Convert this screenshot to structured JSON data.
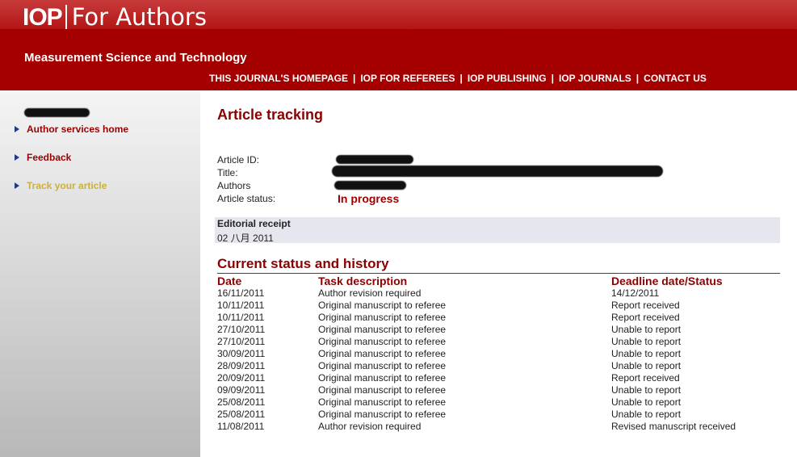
{
  "header": {
    "brand_iop": "IOP",
    "brand_rest": "For Authors",
    "journal": "Measurement Science and Technology",
    "nav": [
      "THIS JOURNAL'S HOMEPAGE",
      "IOP FOR REFEREES",
      "IOP PUBLISHING",
      "IOP JOURNALS",
      "CONTACT US"
    ]
  },
  "sidebar": {
    "items": [
      {
        "label": "Author services home"
      },
      {
        "label": "Feedback"
      },
      {
        "label": "Track your article"
      }
    ]
  },
  "main": {
    "title": "Article tracking",
    "fields": {
      "article_id_label": "Article ID:",
      "title_label": "Title:",
      "authors_label": "Authors",
      "status_label": "Article status:",
      "status_value": "In progress"
    },
    "receipt": {
      "label": "Editorial receipt",
      "value": "02 八月 2011"
    },
    "history_title": "Current status and history",
    "columns": [
      "Date",
      "Task description",
      "Deadline date/Status"
    ],
    "rows": [
      [
        "16/11/2011",
        "Author revision required",
        "14/12/2011"
      ],
      [
        "10/11/2011",
        "Original manuscript to referee",
        "Report received"
      ],
      [
        "10/11/2011",
        "Original manuscript to referee",
        "Report received"
      ],
      [
        "27/10/2011",
        "Original manuscript to referee",
        "Unable to report"
      ],
      [
        "27/10/2011",
        "Original manuscript to referee",
        "Unable to report"
      ],
      [
        "30/09/2011",
        "Original manuscript to referee",
        "Unable to report"
      ],
      [
        "28/09/2011",
        "Original manuscript to referee",
        "Unable to report"
      ],
      [
        "20/09/2011",
        "Original manuscript to referee",
        "Report received"
      ],
      [
        "09/09/2011",
        "Original manuscript to referee",
        "Unable to report"
      ],
      [
        "25/08/2011",
        "Original manuscript to referee",
        "Unable to report"
      ],
      [
        "25/08/2011",
        "Original manuscript to referee",
        "Unable to report"
      ],
      [
        "11/08/2011",
        "Author revision required",
        "Revised manuscript received"
      ]
    ]
  }
}
